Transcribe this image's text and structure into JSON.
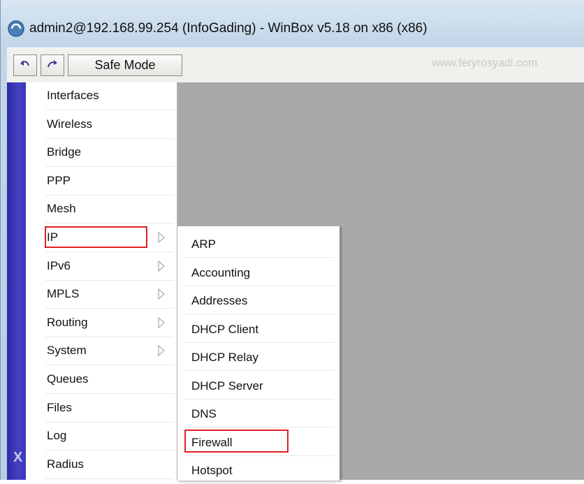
{
  "window": {
    "title": "admin2@192.168.99.254 (InfoGading) - WinBox v5.18 on x86 (x86)"
  },
  "toolbar": {
    "undo_icon": "undo-icon",
    "redo_icon": "redo-icon",
    "safe_mode_label": "Safe Mode",
    "watermark": "www.feryrosyadi.com"
  },
  "sidebar": {
    "strip_text": "X"
  },
  "main_menu": {
    "items": [
      {
        "label": "Interfaces",
        "submenu": false
      },
      {
        "label": "Wireless",
        "submenu": false
      },
      {
        "label": "Bridge",
        "submenu": false
      },
      {
        "label": "PPP",
        "submenu": false
      },
      {
        "label": "Mesh",
        "submenu": false
      },
      {
        "label": "IP",
        "submenu": true,
        "highlighted": true
      },
      {
        "label": "IPv6",
        "submenu": true
      },
      {
        "label": "MPLS",
        "submenu": true
      },
      {
        "label": "Routing",
        "submenu": true
      },
      {
        "label": "System",
        "submenu": true
      },
      {
        "label": "Queues",
        "submenu": false
      },
      {
        "label": "Files",
        "submenu": false
      },
      {
        "label": "Log",
        "submenu": false
      },
      {
        "label": "Radius",
        "submenu": false
      }
    ]
  },
  "ip_submenu": {
    "items": [
      {
        "label": "ARP"
      },
      {
        "label": "Accounting"
      },
      {
        "label": "Addresses"
      },
      {
        "label": "DHCP Client"
      },
      {
        "label": "DHCP Relay"
      },
      {
        "label": "DHCP Server"
      },
      {
        "label": "DNS"
      },
      {
        "label": "Firewall",
        "highlighted": true
      },
      {
        "label": "Hotspot"
      }
    ]
  },
  "colors": {
    "highlight": "#e02020",
    "side_strip": "#3b38b8",
    "workarea": "#a9a9a9"
  }
}
